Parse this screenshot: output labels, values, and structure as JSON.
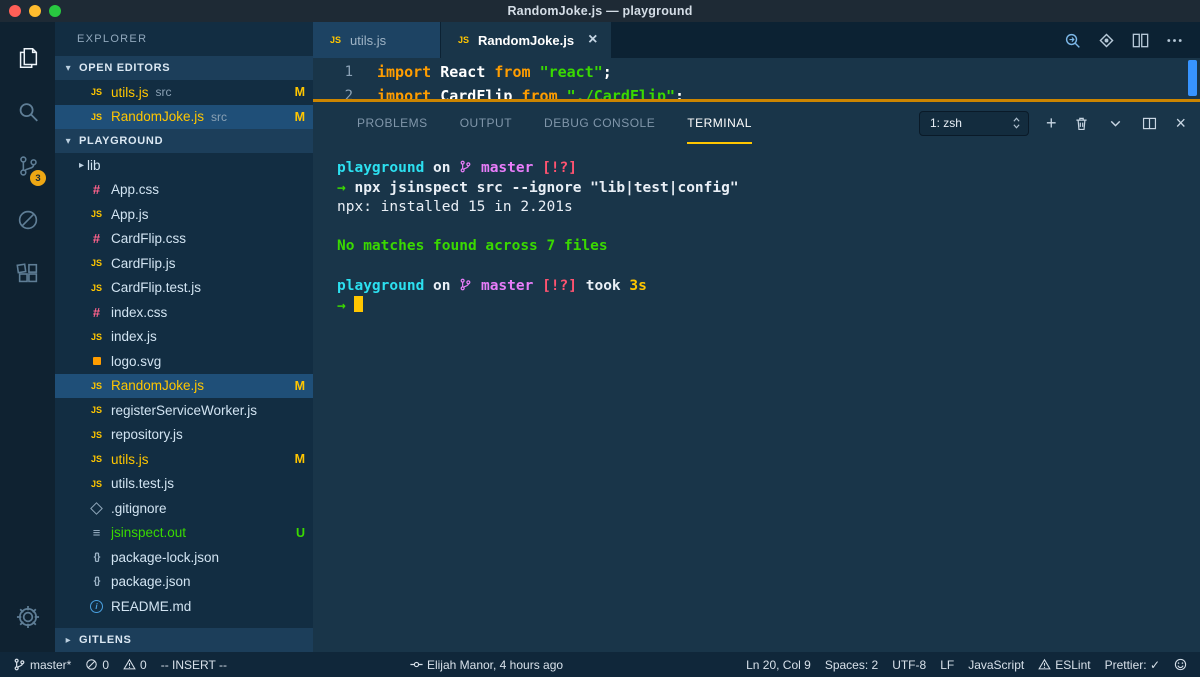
{
  "window": {
    "title": "RandomJoke.js — playground"
  },
  "activity_bar": {
    "items": [
      {
        "id": "explorer",
        "active": true
      },
      {
        "id": "search",
        "active": false
      },
      {
        "id": "source-control",
        "active": false,
        "badge": "3"
      },
      {
        "id": "debug",
        "active": false
      },
      {
        "id": "extensions",
        "active": false
      }
    ],
    "bottom_items": [
      {
        "id": "settings",
        "active": false
      }
    ]
  },
  "sidebar": {
    "title": "EXPLORER",
    "sections": {
      "open_editors": {
        "label": "OPEN EDITORS",
        "items": [
          {
            "name": "utils.js",
            "detail": "src",
            "icon": "js",
            "badge": "M",
            "state": "modified",
            "selected": false
          },
          {
            "name": "RandomJoke.js",
            "detail": "src",
            "icon": "js",
            "badge": "M",
            "state": "modified",
            "selected": true
          }
        ]
      },
      "project": {
        "label": "PLAYGROUND",
        "files": [
          {
            "name": "lib",
            "icon": "folder",
            "kind": "folder"
          },
          {
            "name": "App.css",
            "icon": "css"
          },
          {
            "name": "App.js",
            "icon": "js"
          },
          {
            "name": "CardFlip.css",
            "icon": "css"
          },
          {
            "name": "CardFlip.js",
            "icon": "js"
          },
          {
            "name": "CardFlip.test.js",
            "icon": "js"
          },
          {
            "name": "index.css",
            "icon": "css"
          },
          {
            "name": "index.js",
            "icon": "js"
          },
          {
            "name": "logo.svg",
            "icon": "svg"
          },
          {
            "name": "RandomJoke.js",
            "icon": "js",
            "badge": "M",
            "state": "modified",
            "selected": true
          },
          {
            "name": "registerServiceWorker.js",
            "icon": "js"
          },
          {
            "name": "repository.js",
            "icon": "js"
          },
          {
            "name": "utils.js",
            "icon": "js",
            "badge": "M",
            "state": "modified"
          },
          {
            "name": "utils.test.js",
            "icon": "js"
          },
          {
            "name": ".gitignore",
            "icon": "git"
          },
          {
            "name": "jsinspect.out",
            "icon": "out",
            "badge": "U",
            "state": "untracked"
          },
          {
            "name": "package-lock.json",
            "icon": "json"
          },
          {
            "name": "package.json",
            "icon": "json"
          },
          {
            "name": "README.md",
            "icon": "info"
          }
        ]
      },
      "gitlens": {
        "label": "GITLENS"
      }
    }
  },
  "editor": {
    "tabs": [
      {
        "label": "utils.js",
        "icon": "js",
        "active": false
      },
      {
        "label": "RandomJoke.js",
        "icon": "js",
        "active": true
      }
    ],
    "actions": [
      {
        "id": "open-changes"
      },
      {
        "id": "gitlens"
      },
      {
        "id": "split-editor"
      },
      {
        "id": "more-actions"
      }
    ],
    "code_lines": [
      {
        "number": "1",
        "tokens": [
          {
            "text": "import",
            "style": "keyword"
          },
          {
            "text": " React ",
            "style": "plain"
          },
          {
            "text": "from",
            "style": "keyword"
          },
          {
            "text": " ",
            "style": "plain"
          },
          {
            "text": "\"react\"",
            "style": "string"
          },
          {
            "text": ";",
            "style": "plain"
          }
        ]
      },
      {
        "number": "2",
        "tokens": [
          {
            "text": "import",
            "style": "keyword"
          },
          {
            "text": " CardFlip ",
            "style": "plain"
          },
          {
            "text": "from",
            "style": "keyword"
          },
          {
            "text": " ",
            "style": "plain"
          },
          {
            "text": "\"./CardFlip\"",
            "style": "string"
          },
          {
            "text": ";",
            "style": "plain"
          }
        ]
      }
    ]
  },
  "panel": {
    "tabs": [
      {
        "label": "PROBLEMS",
        "active": false
      },
      {
        "label": "OUTPUT",
        "active": false
      },
      {
        "label": "DEBUG CONSOLE",
        "active": false
      },
      {
        "label": "TERMINAL",
        "active": true
      }
    ],
    "shell_selector": "1: zsh",
    "actions": [
      {
        "id": "new-terminal",
        "glyph": "+"
      },
      {
        "id": "kill-terminal",
        "glyph": "trash"
      },
      {
        "id": "hide-panel",
        "glyph": "chevron-down"
      },
      {
        "id": "split-panel",
        "glyph": "split"
      },
      {
        "id": "close-panel",
        "glyph": "×"
      }
    ],
    "terminal_lines": [
      {
        "spans": [
          {
            "text": "playground",
            "color": "cyan"
          },
          {
            "text": " on ",
            "color": "fg"
          },
          {
            "icon": "branch",
            "color": "magenta"
          },
          {
            "text": " master",
            "color": "magenta"
          },
          {
            "text": " [!?]",
            "color": "red"
          }
        ]
      },
      {
        "spans": [
          {
            "text": "→",
            "color": "green"
          },
          {
            "text": " npx jsinspect src --ignore \"lib|test|config\"",
            "color": "fg"
          }
        ]
      },
      {
        "spans": [
          {
            "text": "npx: installed 15 in 2.201s",
            "color": "fg",
            "weight": "normal"
          }
        ]
      },
      {
        "spans": []
      },
      {
        "spans": [
          {
            "text": "No matches found across 7 files",
            "color": "green"
          }
        ]
      },
      {
        "spans": []
      },
      {
        "spans": [
          {
            "text": "playground",
            "color": "cyan"
          },
          {
            "text": " on ",
            "color": "fg"
          },
          {
            "icon": "branch",
            "color": "magenta"
          },
          {
            "text": " master",
            "color": "magenta"
          },
          {
            "text": " [!?]",
            "color": "red"
          },
          {
            "text": " took ",
            "color": "fg"
          },
          {
            "text": "3s",
            "color": "yellow"
          }
        ]
      },
      {
        "spans": [
          {
            "text": "→ ",
            "color": "green"
          },
          {
            "cursor": true
          }
        ]
      }
    ]
  },
  "status_bar": {
    "left": [
      {
        "id": "branch",
        "icon": "branch",
        "label": "master*"
      },
      {
        "id": "errors",
        "icon": "error",
        "label": "0"
      },
      {
        "id": "warnings",
        "icon": "warning",
        "label": "0"
      },
      {
        "id": "vim-mode",
        "label": "-- INSERT --"
      }
    ],
    "center": [
      {
        "id": "gitlens-blame",
        "icon": "commit",
        "label": "Elijah Manor, 4 hours ago"
      }
    ],
    "right": [
      {
        "id": "cursor-position",
        "label": "Ln 20, Col 9"
      },
      {
        "id": "indentation",
        "label": "Spaces: 2"
      },
      {
        "id": "encoding",
        "label": "UTF-8"
      },
      {
        "id": "eol",
        "label": "LF"
      },
      {
        "id": "language",
        "label": "JavaScript"
      },
      {
        "id": "eslint",
        "icon": "warning",
        "label": "ESLint"
      },
      {
        "id": "prettier",
        "label": "Prettier: ✓"
      },
      {
        "id": "feedback",
        "icon": "smiley",
        "label": ""
      }
    ]
  },
  "colors": {
    "accent_yellow": "#ffc600",
    "keyword_orange": "#ff9d00",
    "string_green": "#3ad900",
    "terminal_cyan": "#2ce0f0",
    "terminal_magenta": "#e97dfa",
    "terminal_red": "#ff5370",
    "badge_modified": "#ffc600",
    "badge_untracked": "#3ad900"
  }
}
